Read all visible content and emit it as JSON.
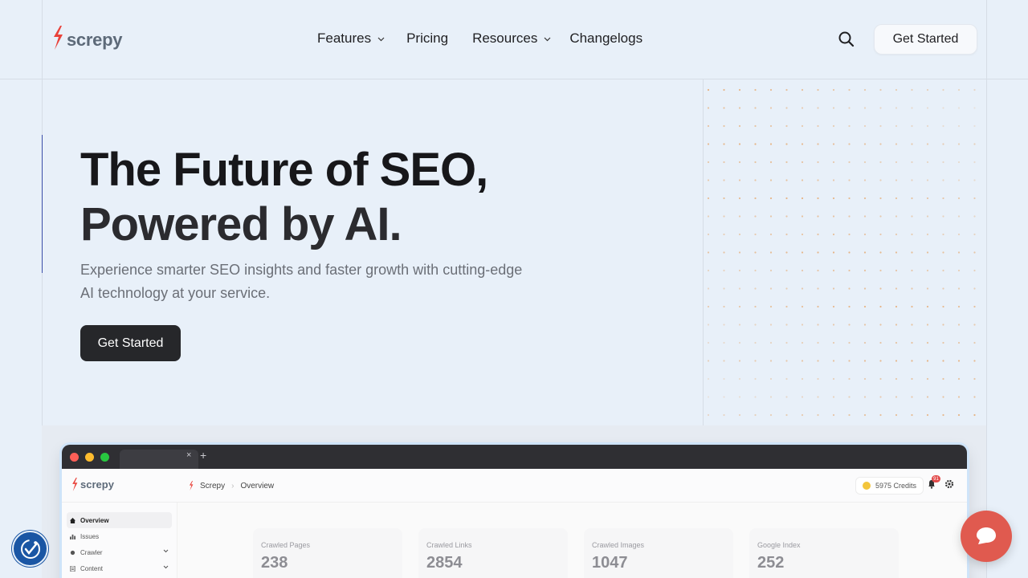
{
  "header": {
    "logo_text": "screpy",
    "nav": [
      {
        "label": "Features",
        "has_dropdown": true
      },
      {
        "label": "Pricing",
        "has_dropdown": false
      },
      {
        "label": "Resources",
        "has_dropdown": true
      },
      {
        "label": "Changelogs",
        "has_dropdown": false
      }
    ],
    "search_icon": "search-icon",
    "cta_label": "Get Started"
  },
  "hero": {
    "title_line1": "The Future of SEO,",
    "title_line2": "Powered by AI.",
    "subtitle": "Experience smarter SEO insights and faster growth with cutting-edge AI technology at your service.",
    "cta_label": "Get Started"
  },
  "app_preview": {
    "tab_close": "×",
    "tab_new": "+",
    "logo_text": "screpy",
    "breadcrumb": [
      "Screpy",
      "Overview"
    ],
    "credits_label": "5975 Credits",
    "notification_count": "91",
    "sidebar": [
      {
        "label": "Overview",
        "icon": "home-icon",
        "active": true
      },
      {
        "label": "Issues",
        "icon": "bar-chart-icon",
        "active": false
      },
      {
        "label": "Crawler",
        "icon": "bug-icon",
        "active": false,
        "expandable": true
      },
      {
        "label": "Content",
        "icon": "document-icon",
        "active": false,
        "expandable": true
      }
    ],
    "stats": [
      {
        "label": "Crawled Pages",
        "value": "238"
      },
      {
        "label": "Crawled Links",
        "value": "2854"
      },
      {
        "label": "Crawled Images",
        "value": "1047"
      },
      {
        "label": "Google Index",
        "value": "252"
      }
    ]
  },
  "colors": {
    "background": "#e8f0f9",
    "brand_red": "#e9423a",
    "dark_button": "#26272a",
    "accessibility_blue": "#1a56a4",
    "chat_red": "#e05a4f",
    "dot_orange": "#e59a52"
  }
}
